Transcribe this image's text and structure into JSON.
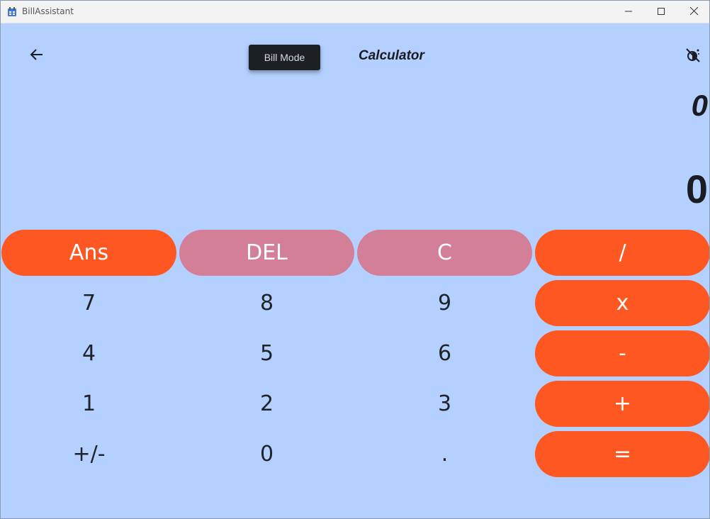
{
  "window": {
    "title": "BillAssistant",
    "icon": "app-icon",
    "controls": [
      "minimize-icon",
      "maximize-icon",
      "close-icon"
    ]
  },
  "header": {
    "back_icon": "arrow-left-icon",
    "mode_button": "Bill Mode",
    "title": "Calculator",
    "theme_icon": "theme-toggle-icon"
  },
  "display": {
    "expression": "0",
    "result": "0"
  },
  "keys": {
    "ans": "Ans",
    "del": "DEL",
    "clear": "C",
    "divide": "/",
    "seven": "7",
    "eight": "8",
    "nine": "9",
    "multiply": "x",
    "four": "4",
    "five": "5",
    "six": "6",
    "minus": "-",
    "one": "1",
    "two": "2",
    "three": "3",
    "plus": "+",
    "sign": "+/-",
    "zero": "0",
    "dot": ".",
    "equals": "="
  },
  "colors": {
    "background": "#b3d0fe",
    "operator": "#ff5722",
    "edit": "#d47f98",
    "mode_button": "#1c1f24"
  }
}
